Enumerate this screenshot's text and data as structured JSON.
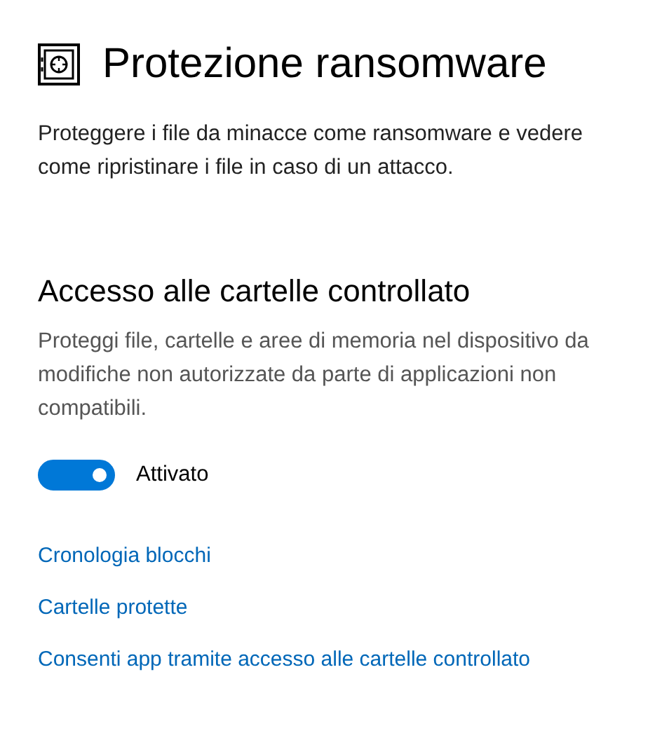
{
  "page": {
    "title": "Protezione ransomware",
    "description": "Proteggere i file da minacce come ransomware e vedere come ripristinare i file in caso di un attacco."
  },
  "section": {
    "heading": "Accesso alle cartelle controllato",
    "description": "Proteggi file, cartelle e aree di memoria nel dispositivo da modifiche non autorizzate da parte di applicazioni non compatibili.",
    "toggle": {
      "on": true,
      "label": "Attivato"
    }
  },
  "links": [
    {
      "label": "Cronologia blocchi"
    },
    {
      "label": "Cartelle protette"
    },
    {
      "label": "Consenti app tramite accesso alle cartelle controllato"
    }
  ]
}
